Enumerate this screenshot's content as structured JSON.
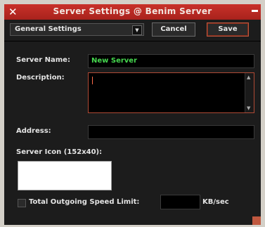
{
  "window": {
    "title": "Server Settings @ Benim Server",
    "close_icon": "close-icon",
    "minimize_icon": "minimize-icon"
  },
  "toolbar": {
    "dropdown_value": "General Settings",
    "cancel_label": "Cancel",
    "save_label": "Save"
  },
  "form": {
    "server_name_label": "Server Name:",
    "server_name_value": "New Server",
    "description_label": "Description:",
    "description_value": "",
    "address_label": "Address:",
    "address_value": "",
    "server_icon_label": "Server Icon (152x40):",
    "speed_limit_label": "Total Outgoing Speed Limit:",
    "speed_limit_value": "",
    "speed_unit": "KB/sec",
    "speed_limit_checked": false
  },
  "colors": {
    "titlebar": "#b8291f",
    "accent": "#c0583f",
    "name_text": "#45d64e"
  }
}
